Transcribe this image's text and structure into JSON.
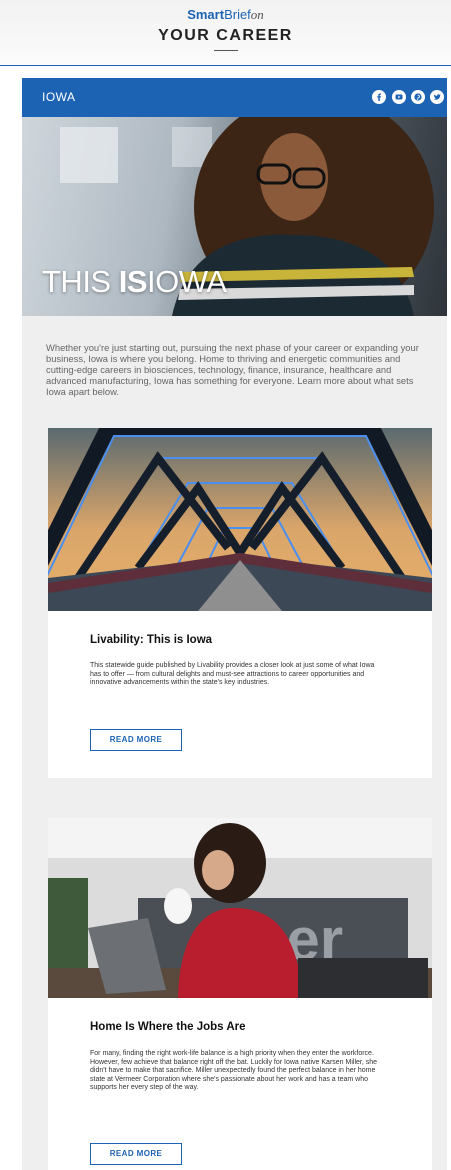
{
  "header": {
    "logo_smart": "Smart",
    "logo_brief": "Brief",
    "logo_on": "on",
    "title": "YOUR CAREER"
  },
  "iowa_bar": {
    "logo": "IOWA",
    "social_icons": [
      "facebook-icon",
      "youtube-icon",
      "pinterest-icon",
      "twitter-icon"
    ]
  },
  "hero": {
    "text_this": "THIS ",
    "text_is": "IS",
    "text_iowa": "IOWA"
  },
  "intro": "Whether you're just starting out, pursuing the next phase of your career or expanding your business, Iowa is where you belong. Home to thriving and energetic communities and cutting-edge careers in biosciences, technology, finance, insurance, healthcare and advanced manufacturing, Iowa has something for everyone. Learn more about what sets Iowa apart below.",
  "articles": [
    {
      "title": "Livability: This is Iowa",
      "body": "This statewide guide published by Livability provides a closer look at just some of what Iowa has to offer — from cultural delights and must-see attractions to career opportunities and innovative advancements within the state's key industries.",
      "button": "READ MORE"
    },
    {
      "title": "Home Is Where the Jobs Are",
      "body": "For many, finding the right work-life balance is a high priority when they enter the workforce. However, few achieve that balance right off the bat. Luckily for Iowa native Karsen Miller, she didn't have to make that sacrifice. Miller unexpectedly found the perfect balance in her home state at Vermeer Corporation where she's passionate about her work and has a team who supports her every step of the way.",
      "button": "READ MORE"
    }
  ],
  "colors": {
    "brand_blue": "#1d63b3",
    "panel_bg": "#efefef"
  }
}
